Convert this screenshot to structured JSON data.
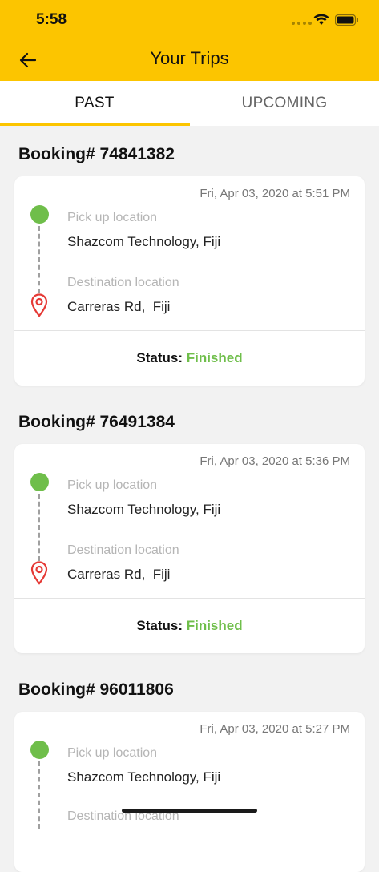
{
  "status_bar": {
    "time": "5:58",
    "icons": [
      "signal-dots-icon",
      "wifi-icon",
      "battery-icon"
    ]
  },
  "header": {
    "title": "Your Trips",
    "back_icon": "arrow-left-icon",
    "background_color": "#fcc500"
  },
  "tabs": [
    {
      "label": "PAST",
      "active": true
    },
    {
      "label": "UPCOMING",
      "active": false
    }
  ],
  "bookings": [
    {
      "title": "Booking# 74841382",
      "datetime": "Fri, Apr 03, 2020 at 5:51 PM",
      "pickup_label": "Pick up location",
      "pickup_value": "Shazcom Technology, Fiji",
      "destination_label": "Destination location",
      "destination_value": "Carreras Rd,  Fiji",
      "status_label": "Status: ",
      "status_value": "Finished"
    },
    {
      "title": "Booking# 76491384",
      "datetime": "Fri, Apr 03, 2020 at 5:36 PM",
      "pickup_label": "Pick up location",
      "pickup_value": "Shazcom Technology, Fiji",
      "destination_label": "Destination location",
      "destination_value": "Carreras Rd,  Fiji",
      "status_label": "Status: ",
      "status_value": "Finished"
    },
    {
      "title": "Booking# 96011806",
      "datetime": "Fri, Apr 03, 2020 at 5:27 PM",
      "pickup_label": "Pick up location",
      "pickup_value": "Shazcom Technology, Fiji",
      "destination_label": "Destination location"
    }
  ],
  "colors": {
    "accent": "#fcc500",
    "status_finished": "#6fbe4a",
    "pickup_marker": "#6fbe4a",
    "destination_marker": "#e53935"
  }
}
